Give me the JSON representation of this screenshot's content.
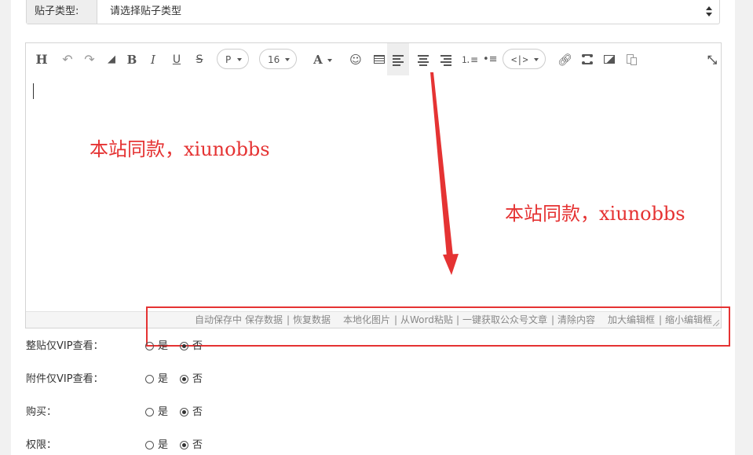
{
  "post_type": {
    "label": "贴子类型:",
    "placeholder": "请选择贴子类型"
  },
  "toolbar": {
    "heading": "H",
    "bold": "B",
    "italic": "I",
    "underline": "U",
    "strike": "S",
    "paragraph": "P",
    "font_size": "16",
    "font_color": "A",
    "emoji": "☺",
    "code": "<|>"
  },
  "status_bar": {
    "autosave": "自动保存中",
    "save": "保存数据",
    "restore": "恢复数据",
    "localize_images": "本地化图片",
    "paste_word": "从Word粘贴",
    "fetch_wechat": "一键获取公众号文章",
    "clear": "清除内容",
    "enlarge": "加大编辑框",
    "shrink": "缩小编辑框",
    "sep": "|"
  },
  "annotations": {
    "watermark_1": "本站同款，xiunobbs",
    "watermark_2": "本站同款，xiunobbs"
  },
  "options": [
    {
      "label": "整贴仅VIP查看：",
      "yes": "是",
      "no": "否",
      "selected": "否"
    },
    {
      "label": "附件仅VIP查看：",
      "yes": "是",
      "no": "否",
      "selected": "否"
    },
    {
      "label": "购买：",
      "yes": "是",
      "no": "否",
      "selected": "否"
    },
    {
      "label": "权限：",
      "yes": "是",
      "no": "否",
      "selected": "否"
    }
  ],
  "colors": {
    "annotation_red": "#e53333",
    "border": "#d4d4d4",
    "label_bg": "#eeeeee"
  }
}
